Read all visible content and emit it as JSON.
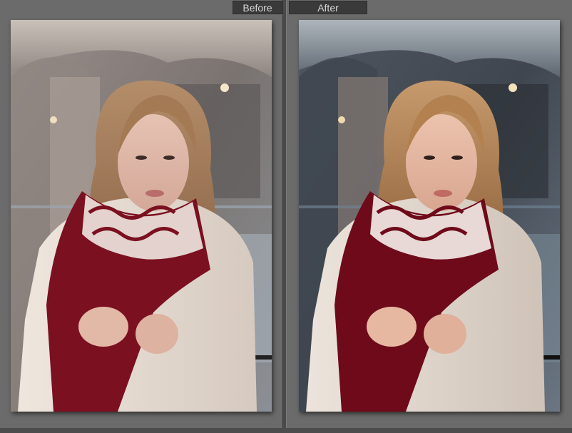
{
  "compare_view": {
    "before_label": "Before",
    "after_label": "After"
  },
  "colors": {
    "panel_bg": "#6b6b6b",
    "tab_bg": "#3a3a3a",
    "tab_text": "#d6d6d6",
    "scarf_red": "#7a1020",
    "coat_cream": "#e8ddd2"
  }
}
